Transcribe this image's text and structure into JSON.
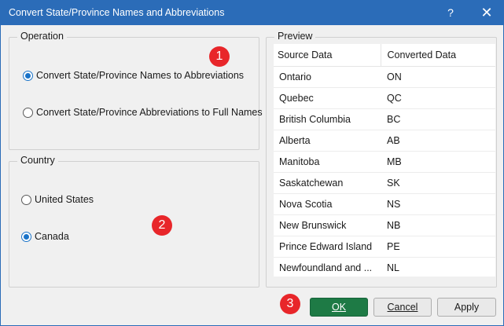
{
  "window": {
    "title": "Convert State/Province Names and Abbreviations",
    "help_label": "?",
    "close_label": "✕"
  },
  "operation": {
    "legend": "Operation",
    "options": [
      {
        "label": "Convert State/Province Names to Abbreviations",
        "checked": true
      },
      {
        "label": "Convert State/Province Abbreviations to Full Names",
        "checked": false
      }
    ]
  },
  "country": {
    "legend": "Country",
    "options": [
      {
        "label": "United States",
        "checked": false
      },
      {
        "label": "Canada",
        "checked": true
      }
    ]
  },
  "preview": {
    "legend": "Preview",
    "columns": [
      "Source Data",
      "Converted Data"
    ],
    "rows": [
      [
        "Ontario",
        "ON"
      ],
      [
        "Quebec",
        "QC"
      ],
      [
        "British Columbia",
        "BC"
      ],
      [
        "Alberta",
        "AB"
      ],
      [
        "Manitoba",
        "MB"
      ],
      [
        "Saskatchewan",
        "SK"
      ],
      [
        "Nova Scotia",
        "NS"
      ],
      [
        "New Brunswick",
        "NB"
      ],
      [
        "Prince Edward Island",
        "PE"
      ],
      [
        "Newfoundland and ...",
        "NL"
      ]
    ]
  },
  "markers": [
    "1",
    "2",
    "3"
  ],
  "buttons": {
    "ok": "OK",
    "cancel": "Cancel",
    "apply": "Apply"
  },
  "colors": {
    "titlebar": "#2b6cb8",
    "ok_button": "#1e7a45",
    "marker": "#e8262a",
    "radio_accent": "#1a73c8"
  }
}
